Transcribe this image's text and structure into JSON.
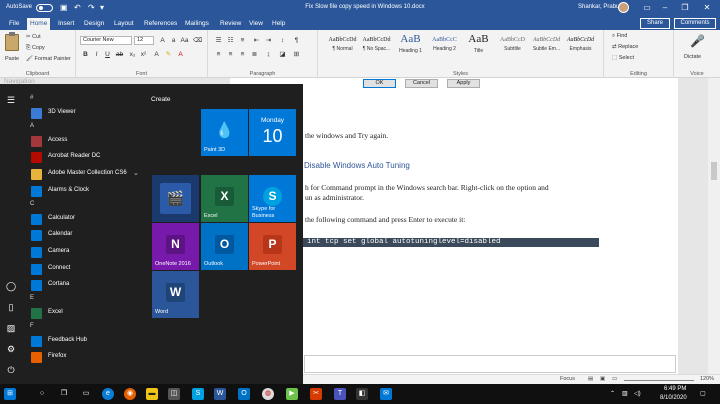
{
  "titlebar": {
    "autosave": "AutoSave",
    "doc_title": "Fix Slow file copy speed in Windows 10.docx",
    "user": "Shankar, Prabu"
  },
  "tabs": [
    "File",
    "Home",
    "Insert",
    "Design",
    "Layout",
    "References",
    "Mailings",
    "Review",
    "View",
    "Help"
  ],
  "share": "Share",
  "comments": "Comments",
  "ribbon": {
    "clipboard": {
      "paste": "Paste",
      "cut": "Cut",
      "copy": "Copy",
      "format_painter": "Format Painter",
      "label": "Clipboard"
    },
    "font": {
      "name": "Courier New",
      "size": "12",
      "label": "Font"
    },
    "paragraph": {
      "label": "Paragraph"
    },
    "styles": {
      "items": [
        {
          "sample": "AaBbCcDd",
          "name": "¶ Normal"
        },
        {
          "sample": "AaBbCcDd",
          "name": "¶ No Spac..."
        },
        {
          "sample": "AaB",
          "name": "Heading 1"
        },
        {
          "sample": "AaBbCcC",
          "name": "Heading 2"
        },
        {
          "sample": "AaB",
          "name": "Title"
        },
        {
          "sample": "AaBbCcD",
          "name": "Subtitle"
        },
        {
          "sample": "AaBbCcDd",
          "name": "Subtle Em..."
        },
        {
          "sample": "AaBbCcDd",
          "name": "Emphasis"
        }
      ],
      "label": "Styles"
    },
    "editing": {
      "find": "Find",
      "replace": "Replace",
      "select": "Select",
      "label": "Editing"
    },
    "voice": {
      "dictate": "Dictate",
      "label": "Voice"
    }
  },
  "document": {
    "navigation": "Navigation",
    "dialog_ok": "OK",
    "dialog_cancel": "Cancel",
    "dialog_apply": "Apply",
    "line1": "the windows and Try again.",
    "heading": "Disable Windows Auto Tuning",
    "line2": "h for Command prompt in the Windows search bar. Right-click on the option and",
    "line3": "un as administrator.",
    "line4": "the following command and press Enter to execute it:",
    "command": "int tcp set global autotuninglevel=disabled"
  },
  "statusbar": {
    "focus": "Focus",
    "zoom": "120%"
  },
  "start": {
    "create_label": "Create",
    "apps": [
      {
        "letter": "#"
      },
      {
        "name": "3D Viewer",
        "color": "#3a7bd5"
      },
      {
        "letter": "A"
      },
      {
        "name": "Access",
        "color": "#a4373a"
      },
      {
        "name": "Acrobat Reader DC",
        "color": "#b30b00"
      },
      {
        "name": "Adobe Master Collection CS6",
        "color": "#e6b33c",
        "chevron": "⌄"
      },
      {
        "name": "Alarms & Clock",
        "color": "#0078d7"
      },
      {
        "letter": "C"
      },
      {
        "name": "Calculator",
        "color": "#0078d7"
      },
      {
        "name": "Calendar",
        "color": "#0078d7"
      },
      {
        "name": "Camera",
        "color": "#0078d7"
      },
      {
        "name": "Connect",
        "color": "#0078d7"
      },
      {
        "name": "Cortana",
        "color": "#0078d7"
      },
      {
        "letter": "E"
      },
      {
        "name": "Excel",
        "color": "#217346"
      },
      {
        "letter": "F"
      },
      {
        "name": "Feedback Hub",
        "color": "#0078d7"
      },
      {
        "name": "Firefox",
        "color": "#e66000"
      }
    ],
    "tiles": {
      "paint3d": "Paint 3D",
      "calendar_day": "Monday",
      "calendar_date": "10",
      "excel": "Excel",
      "skype": "Skype for Business",
      "onenote": "OneNote 2016",
      "outlook": "Outlook",
      "powerpoint": "PowerPoint",
      "word": "Word"
    }
  },
  "taskbar": {
    "time": "6:49 PM",
    "date": "8/10/2020"
  }
}
